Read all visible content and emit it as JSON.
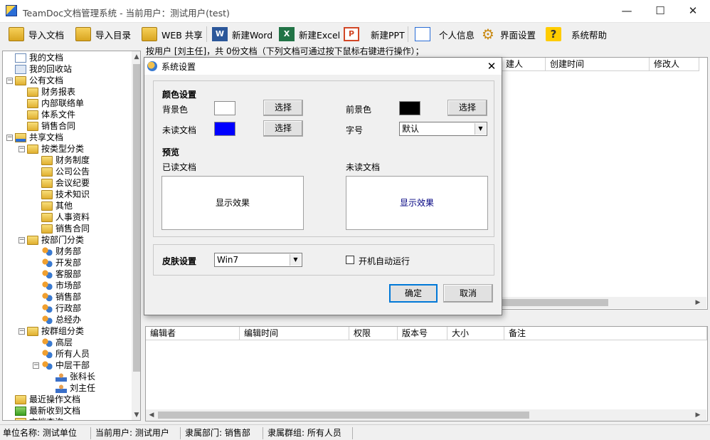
{
  "window": {
    "title": "TeamDoc文档管理系统 - 当前用户：测试用户(test)",
    "minimize": "—",
    "maximize": "☐",
    "close": "✕"
  },
  "toolbar": {
    "import_doc": "导入文档",
    "import_dir": "导入目录",
    "web_share": "WEB 共享",
    "new_word": "新建Word",
    "new_excel": "新建Excel",
    "new_ppt": "新建PPT",
    "personal_info": "个人信息",
    "ui_settings": "界面设置",
    "help": "系统帮助",
    "word_glyph": "W",
    "excel_glyph": "X",
    "ppt_glyph": "P",
    "gear_glyph": "⚙",
    "help_glyph": "?"
  },
  "tree": {
    "items": [
      {
        "label": "我的文档",
        "level": 0,
        "icon": "doc",
        "expander": ""
      },
      {
        "label": "我的回收站",
        "level": 0,
        "icon": "bin",
        "expander": ""
      },
      {
        "label": "公有文档",
        "level": 0,
        "icon": "fd",
        "expander": "−"
      },
      {
        "label": "财务报表",
        "level": 1,
        "icon": "fd",
        "expander": ""
      },
      {
        "label": "内部联络单",
        "level": 1,
        "icon": "fd",
        "expander": ""
      },
      {
        "label": "体系文件",
        "level": 1,
        "icon": "fd",
        "expander": ""
      },
      {
        "label": "销售合同",
        "level": 1,
        "icon": "fd",
        "expander": ""
      },
      {
        "label": "共享文档",
        "level": 0,
        "icon": "share",
        "expander": "−"
      },
      {
        "label": "按类型分类",
        "level": 1,
        "icon": "fd",
        "expander": "−"
      },
      {
        "label": "财务制度",
        "level": 2,
        "icon": "fd",
        "expander": ""
      },
      {
        "label": "公司公告",
        "level": 2,
        "icon": "fd",
        "expander": ""
      },
      {
        "label": "会议纪要",
        "level": 2,
        "icon": "fd",
        "expander": ""
      },
      {
        "label": "技术知识",
        "level": 2,
        "icon": "fd",
        "expander": ""
      },
      {
        "label": "其他",
        "level": 2,
        "icon": "fd",
        "expander": ""
      },
      {
        "label": "人事资料",
        "level": 2,
        "icon": "fd",
        "expander": ""
      },
      {
        "label": "销售合同",
        "level": 2,
        "icon": "fd",
        "expander": ""
      },
      {
        "label": "按部门分类",
        "level": 1,
        "icon": "fd",
        "expander": "−"
      },
      {
        "label": "财务部",
        "level": 2,
        "icon": "grp",
        "expander": ""
      },
      {
        "label": "开发部",
        "level": 2,
        "icon": "grp",
        "expander": ""
      },
      {
        "label": "客服部",
        "level": 2,
        "icon": "grp",
        "expander": ""
      },
      {
        "label": "市场部",
        "level": 2,
        "icon": "grp",
        "expander": ""
      },
      {
        "label": "销售部",
        "level": 2,
        "icon": "grp",
        "expander": ""
      },
      {
        "label": "行政部",
        "level": 2,
        "icon": "grp",
        "expander": ""
      },
      {
        "label": "总经办",
        "level": 2,
        "icon": "grp",
        "expander": ""
      },
      {
        "label": "按群组分类",
        "level": 1,
        "icon": "fd",
        "expander": "−"
      },
      {
        "label": "高层",
        "level": 2,
        "icon": "grp",
        "expander": ""
      },
      {
        "label": "所有人员",
        "level": 2,
        "icon": "grp",
        "expander": ""
      },
      {
        "label": "中层干部",
        "level": 2,
        "icon": "grp",
        "expander": "−"
      },
      {
        "label": "张科长",
        "level": 3,
        "icon": "usr",
        "expander": ""
      },
      {
        "label": "刘主任",
        "level": 3,
        "icon": "usr",
        "expander": ""
      },
      {
        "label": "最近操作文档",
        "level": 0,
        "icon": "fd",
        "expander": ""
      },
      {
        "label": "最新收到文档",
        "level": 0,
        "icon": "arr",
        "expander": ""
      },
      {
        "label": "文档查询",
        "level": 0,
        "icon": "fd",
        "expander": ""
      }
    ],
    "scroll_up": "▲",
    "scroll_down": "▼"
  },
  "main": {
    "header": "按用户 [刘主任]，共 0份文档（下列文档可通过按下鼠标右键进行操作）；",
    "top_columns": [
      "建人",
      "创建时间",
      "修改人"
    ],
    "bottom_columns": [
      "编辑者",
      "编辑时间",
      "权限",
      "版本号",
      "大小",
      "备注"
    ],
    "scroll_left": "◀",
    "scroll_right": "▶"
  },
  "status": {
    "unit": "单位名称: 测试单位",
    "user": "当前用户: 测试用户",
    "dept": "隶属部门: 销售部",
    "group": "隶属群组: 所有人员"
  },
  "dialog": {
    "title": "系统设置",
    "close": "✕",
    "color_section": "颜色设置",
    "background": "背景色",
    "foreground": "前景色",
    "unread_doc": "未读文档",
    "font_size": "字号",
    "choose": "选择",
    "font_size_value": "默认",
    "preview_section": "预览",
    "read_doc": "已读文档",
    "unread_doc_preview": "未读文档",
    "preview_text": "显示效果",
    "skin_section": "皮肤设置",
    "skin_value": "Win7",
    "autostart": "开机自动运行",
    "ok": "确定",
    "cancel": "取消",
    "dropdown_glyph": "▼",
    "colors": {
      "background": "#ffffff",
      "foreground": "#000000",
      "unread": "#0000ff",
      "unread_preview_text": "#000080"
    }
  }
}
